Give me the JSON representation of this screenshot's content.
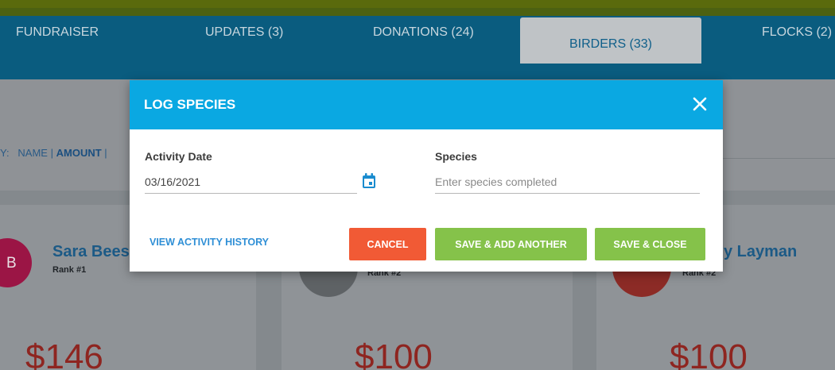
{
  "tabs": [
    {
      "label": "FUNDRAISER"
    },
    {
      "label": "UPDATES (3)"
    },
    {
      "label": "DONATIONS (24)"
    },
    {
      "label": "BIRDERS (33)"
    },
    {
      "label": "FLOCKS (2)"
    }
  ],
  "sort": {
    "prefix": "Y:",
    "name": "NAME",
    "sep1": "|",
    "amount": "AMOUNT",
    "sep2": "|"
  },
  "birders": [
    {
      "initials": "B",
      "name": "Sara Bees",
      "rank": "Rank #1",
      "amount": "$146"
    },
    {
      "initials": "",
      "name": "",
      "rank": "Rank #2",
      "amount": "$100"
    },
    {
      "initials": "",
      "name": "y Layman",
      "rank": "Rank #2",
      "amount": "$100"
    }
  ],
  "modal": {
    "title": "LOG SPECIES",
    "activity_date": {
      "label": "Activity Date",
      "value": "03/16/2021"
    },
    "species": {
      "label": "Species",
      "placeholder": "Enter species completed"
    },
    "history_link": "VIEW ACTIVITY HISTORY",
    "cancel": "CANCEL",
    "save_add": "SAVE & ADD ANOTHER",
    "save_close": "SAVE & CLOSE"
  },
  "colors": {
    "header": "#0aa8e2",
    "cancel": "#f15a35",
    "save": "#85c24a",
    "link": "#2f8fd6"
  },
  "icons": {
    "close": "close-icon",
    "calendar": "calendar-icon"
  }
}
